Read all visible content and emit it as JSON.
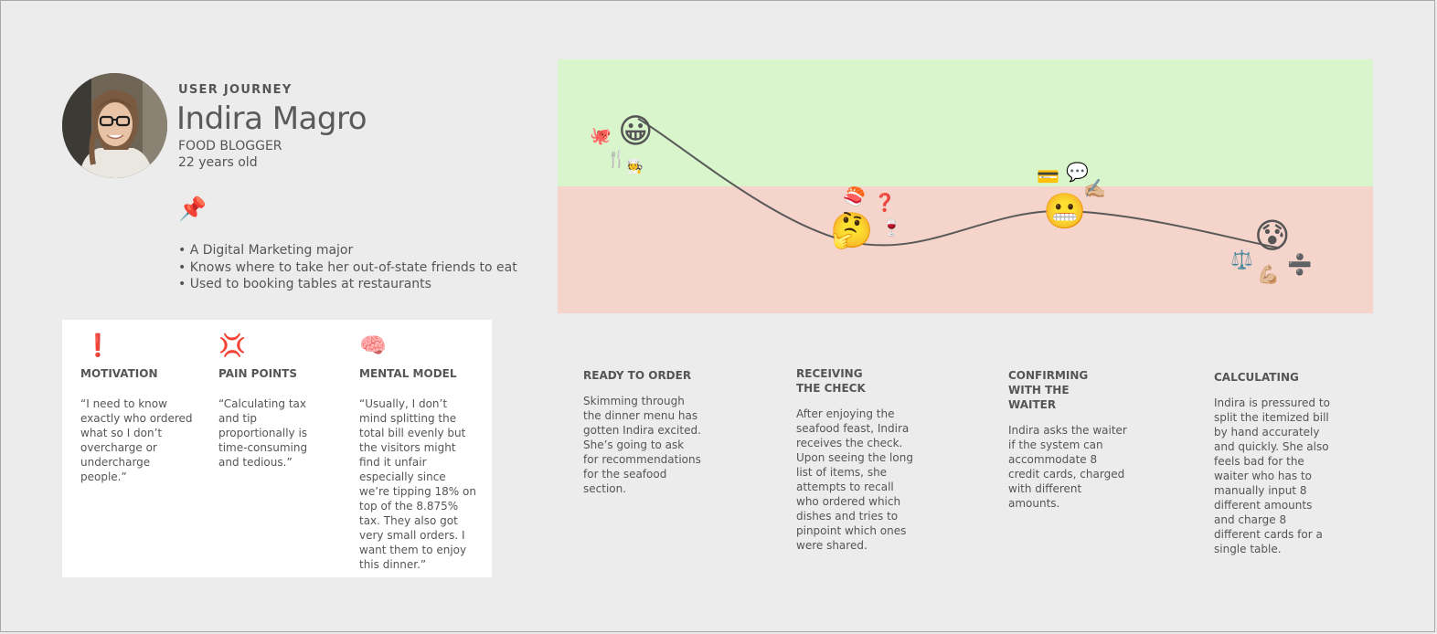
{
  "persona": {
    "eyebrow": "USER JOURNEY",
    "name": "Indira Magro",
    "role": "FOOD BLOGGER",
    "age": "22 years old",
    "pin_icon": "pushpin-icon",
    "facts": [
      "• A Digital Marketing major",
      "• Knows where to take her out-of-state friends to eat",
      "• Used to booking tables at restaurants"
    ]
  },
  "card": {
    "columns": [
      {
        "icon": "exclamation-icon",
        "glyph": "❗",
        "title": "MOTIVATION",
        "text": "“I need to know exactly who ordered what so I don’t overcharge or undercharge people.”"
      },
      {
        "icon": "anger-icon",
        "glyph": "💢",
        "title": "PAIN POINTS",
        "text": "“Calculating tax and tip proportionally is time-consuming and tedious.”"
      },
      {
        "icon": "brain-icon",
        "glyph": "🧠",
        "title": "MENTAL MODEL",
        "text": "“Usually, I don’t mind splitting the total bill evenly but the visitors might find it unfair especially since we’re tipping 18% on top of the 8.875% tax. They also got very small orders. I want them to enjoy this dinner.”"
      }
    ]
  },
  "journey": {
    "colors": {
      "positive_band": "#d9f5cb",
      "negative_band": "#f5d4cb",
      "line": "#595959"
    },
    "stages": [
      {
        "title": "READY TO ORDER",
        "description": "Skimming through the dinner menu has gotten Indira excited. She’s going to ask for recommendations for the seafood section.",
        "face": "grinning-face-icon",
        "face_glyph": "😀",
        "emotion": 0.55,
        "extras": [
          "octopus-icon",
          "fork-knife-icon",
          "chef-icon"
        ]
      },
      {
        "title": "RECEIVING THE CHECK",
        "description": "After enjoying the seafood feast, Indira receives the check. Upon seeing the long list of items, she attempts to recall who ordered which dishes and tries to pinpoint which ones were shared.",
        "face": "thinking-face-icon",
        "face_glyph": "🤔",
        "emotion": -0.45,
        "extras": [
          "sushi-icon",
          "question-mark-icon",
          "wine-glass-icon"
        ]
      },
      {
        "title": "CONFIRMING WITH THE WAITER",
        "description": "Indira asks the waiter if the system can accommodate 8 credit cards, charged with different amounts.",
        "face": "grimacing-face-icon",
        "face_glyph": "😬",
        "emotion": -0.2,
        "extras": [
          "credit-card-icon",
          "speech-bubble-icon",
          "writing-hand-icon"
        ]
      },
      {
        "title": "CALCULATING",
        "description": "Indira is pressured to split the itemized bill by hand accurately and quickly. She also feels bad for the waiter who has to manually input 8 different amounts and charge 8 different cards for a single table.",
        "face": "anxious-face-icon",
        "face_glyph": "😰",
        "emotion": -0.5,
        "extras": [
          "scales-icon",
          "flexed-biceps-icon",
          "division-sign-icon"
        ]
      }
    ]
  }
}
